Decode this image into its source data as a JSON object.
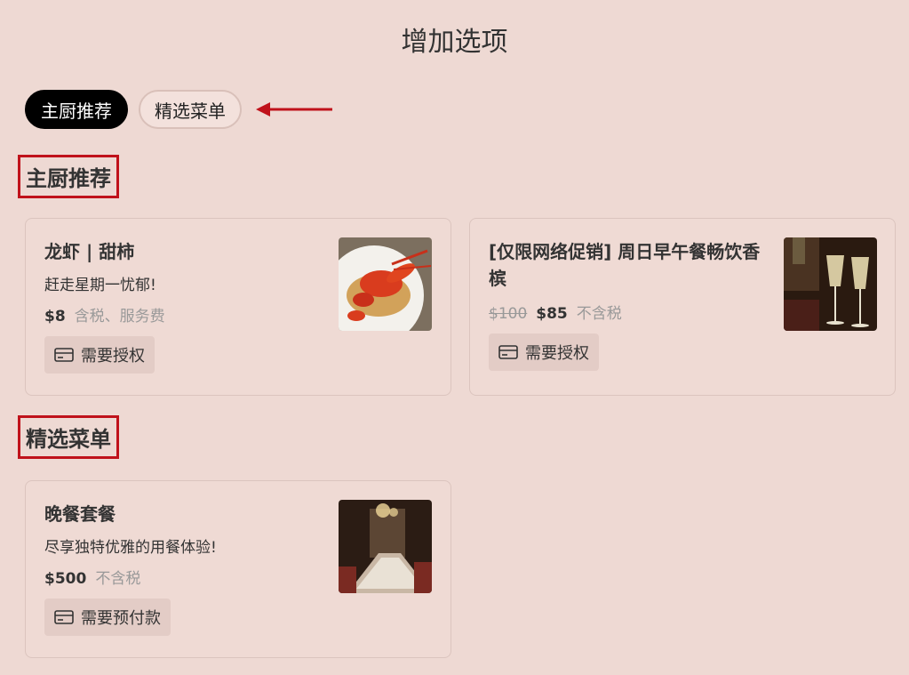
{
  "page": {
    "title": "增加选项"
  },
  "tabs": [
    {
      "label": "主厨推荐",
      "active": true
    },
    {
      "label": "精选菜单",
      "active": false
    }
  ],
  "annotation_color": "#c0121b",
  "sections": [
    {
      "heading": "主厨推荐",
      "items": [
        {
          "name": "龙虾 | 甜柿",
          "description": "赶走星期一忧郁!",
          "price": "$8",
          "tax_note": "含税、服务费",
          "badge": "需要授权",
          "badge_icon": "credit-card-icon",
          "image": "lobster-dish"
        },
        {
          "name_line1": "[仅限网络促销] 周日早午餐畅饮香",
          "name_line2": "槟",
          "original_price": "$100",
          "price": "$85",
          "tax_note": "不含税",
          "badge": "需要授权",
          "badge_icon": "credit-card-icon",
          "image": "champagne-glasses"
        }
      ]
    },
    {
      "heading": "精选菜单",
      "items": [
        {
          "name": "晚餐套餐",
          "description": "尽享独特优雅的用餐体验!",
          "price": "$500",
          "tax_note": "不含税",
          "badge": "需要预付款",
          "badge_icon": "credit-card-icon",
          "image": "private-dining-room"
        }
      ]
    }
  ]
}
